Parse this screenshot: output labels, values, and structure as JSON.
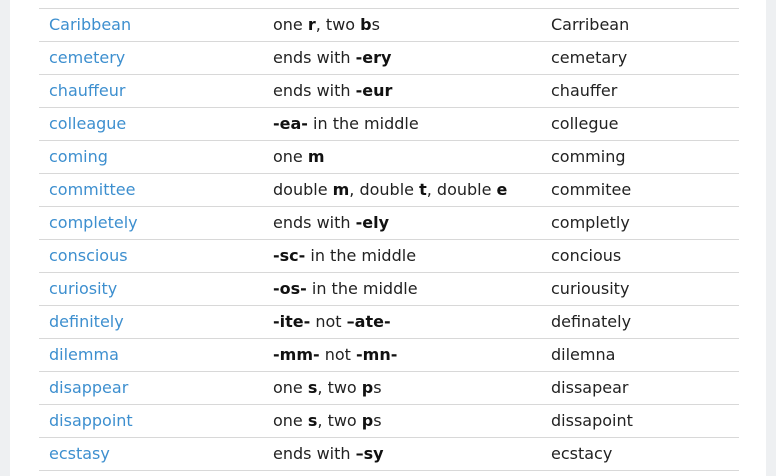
{
  "rows": [
    {
      "word": "Caribbean",
      "rule": [
        [
          "one ",
          false
        ],
        [
          "r",
          true
        ],
        [
          ", two ",
          false
        ],
        [
          "b",
          true
        ],
        [
          "s",
          false
        ]
      ],
      "misspelling": "Carribean"
    },
    {
      "word": "cemetery",
      "rule": [
        [
          "ends with ",
          false
        ],
        [
          "-ery",
          true
        ]
      ],
      "misspelling": "cemetary"
    },
    {
      "word": "chauffeur",
      "rule": [
        [
          "ends with ",
          false
        ],
        [
          "-eur",
          true
        ]
      ],
      "misspelling": "chauffer"
    },
    {
      "word": "colleague",
      "rule": [
        [
          "-ea-",
          true
        ],
        [
          " in the middle",
          false
        ]
      ],
      "misspelling": "collegue"
    },
    {
      "word": "coming",
      "rule": [
        [
          "one ",
          false
        ],
        [
          "m",
          true
        ]
      ],
      "misspelling": "comming"
    },
    {
      "word": "committee",
      "rule": [
        [
          "double ",
          false
        ],
        [
          "m",
          true
        ],
        [
          ", double ",
          false
        ],
        [
          "t",
          true
        ],
        [
          ", double ",
          false
        ],
        [
          "e",
          true
        ]
      ],
      "misspelling": "commitee"
    },
    {
      "word": "completely",
      "rule": [
        [
          "ends with ",
          false
        ],
        [
          "-ely",
          true
        ]
      ],
      "misspelling": "completly"
    },
    {
      "word": "conscious",
      "rule": [
        [
          "-sc-",
          true
        ],
        [
          " in the middle",
          false
        ]
      ],
      "misspelling": "concious"
    },
    {
      "word": "curiosity",
      "rule": [
        [
          "-os-",
          true
        ],
        [
          " in the middle",
          false
        ]
      ],
      "misspelling": "curiousity"
    },
    {
      "word": "definitely",
      "rule": [
        [
          "-ite-",
          true
        ],
        [
          " not ",
          false
        ],
        [
          "–ate-",
          true
        ]
      ],
      "misspelling": "definately"
    },
    {
      "word": "dilemma",
      "rule": [
        [
          "-mm-",
          true
        ],
        [
          " not ",
          false
        ],
        [
          "-mn-",
          true
        ]
      ],
      "misspelling": "dilemna"
    },
    {
      "word": "disappear",
      "rule": [
        [
          "one ",
          false
        ],
        [
          "s",
          true
        ],
        [
          ", two ",
          false
        ],
        [
          "p",
          true
        ],
        [
          "s",
          false
        ]
      ],
      "misspelling": "dissapear"
    },
    {
      "word": "disappoint",
      "rule": [
        [
          "one ",
          false
        ],
        [
          "s",
          true
        ],
        [
          ", two ",
          false
        ],
        [
          "p",
          true
        ],
        [
          "s",
          false
        ]
      ],
      "misspelling": "dissapoint"
    },
    {
      "word": "ecstasy",
      "rule": [
        [
          "ends with ",
          false
        ],
        [
          "–sy",
          true
        ]
      ],
      "misspelling": "ecstacy"
    }
  ]
}
